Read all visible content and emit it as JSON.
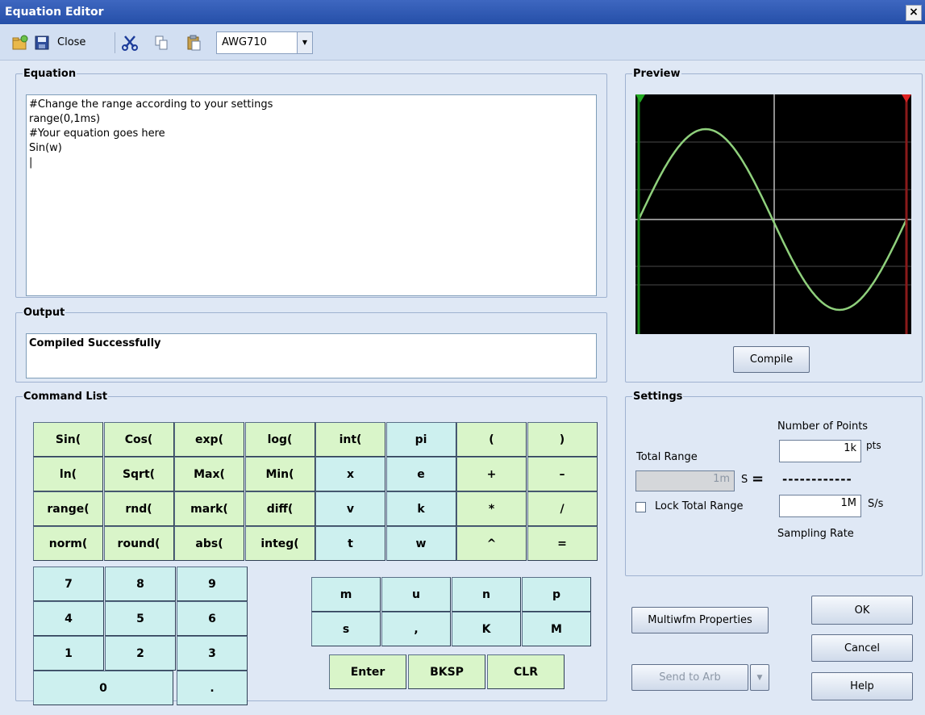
{
  "window": {
    "title": "Equation Editor",
    "close_glyph": "×"
  },
  "toolbar": {
    "close_label": "Close",
    "instrument": "AWG710"
  },
  "equation": {
    "legend": "Equation",
    "text": "#Change the range according to your settings\nrange(0,1ms)\n#Your equation goes here\nSin(w)\n|"
  },
  "output": {
    "legend": "Output",
    "text": "Compiled Successfully"
  },
  "preview": {
    "legend": "Preview",
    "compile_label": "Compile",
    "trace_color": "#8fd07c"
  },
  "command_list": {
    "legend": "Command List",
    "rows": [
      [
        "Sin(",
        "Cos(",
        "exp(",
        "log(",
        "int(",
        "pi",
        "(",
        ")"
      ],
      [
        "ln(",
        "Sqrt(",
        "Max(",
        "Min(",
        "x",
        "e",
        "+",
        "–"
      ],
      [
        "range(",
        "rnd(",
        "mark(",
        "diff(",
        "v",
        "k",
        "*",
        "/"
      ],
      [
        "norm(",
        "round(",
        "abs(",
        "integ(",
        "t",
        "w",
        "^",
        "="
      ]
    ],
    "numpad": [
      [
        "7",
        "8",
        "9"
      ],
      [
        "4",
        "5",
        "6"
      ],
      [
        "1",
        "2",
        "3"
      ]
    ],
    "zero": "0",
    "dot": ".",
    "units": [
      [
        "m",
        "u",
        "n",
        "p"
      ],
      [
        "s",
        ",",
        "K",
        "M"
      ]
    ],
    "enter": "Enter",
    "bksp": "BKSP",
    "clr": "CLR"
  },
  "settings": {
    "legend": "Settings",
    "total_range_label": "Total Range",
    "total_range_value": "1m",
    "total_range_unit": "S",
    "equals": "=",
    "number_of_points_label": "Number of Points",
    "number_of_points_value": "1k",
    "points_unit": "pts",
    "dashes": "------------",
    "lock_label": "Lock Total Range",
    "sampling_rate_value": "1M",
    "sampling_rate_unit": "S/s",
    "sampling_rate_label": "Sampling Rate"
  },
  "buttons": {
    "multiwfm": "Multiwfm Properties",
    "send_to_arb": "Send to Arb",
    "ok": "OK",
    "cancel": "Cancel",
    "help": "Help"
  }
}
